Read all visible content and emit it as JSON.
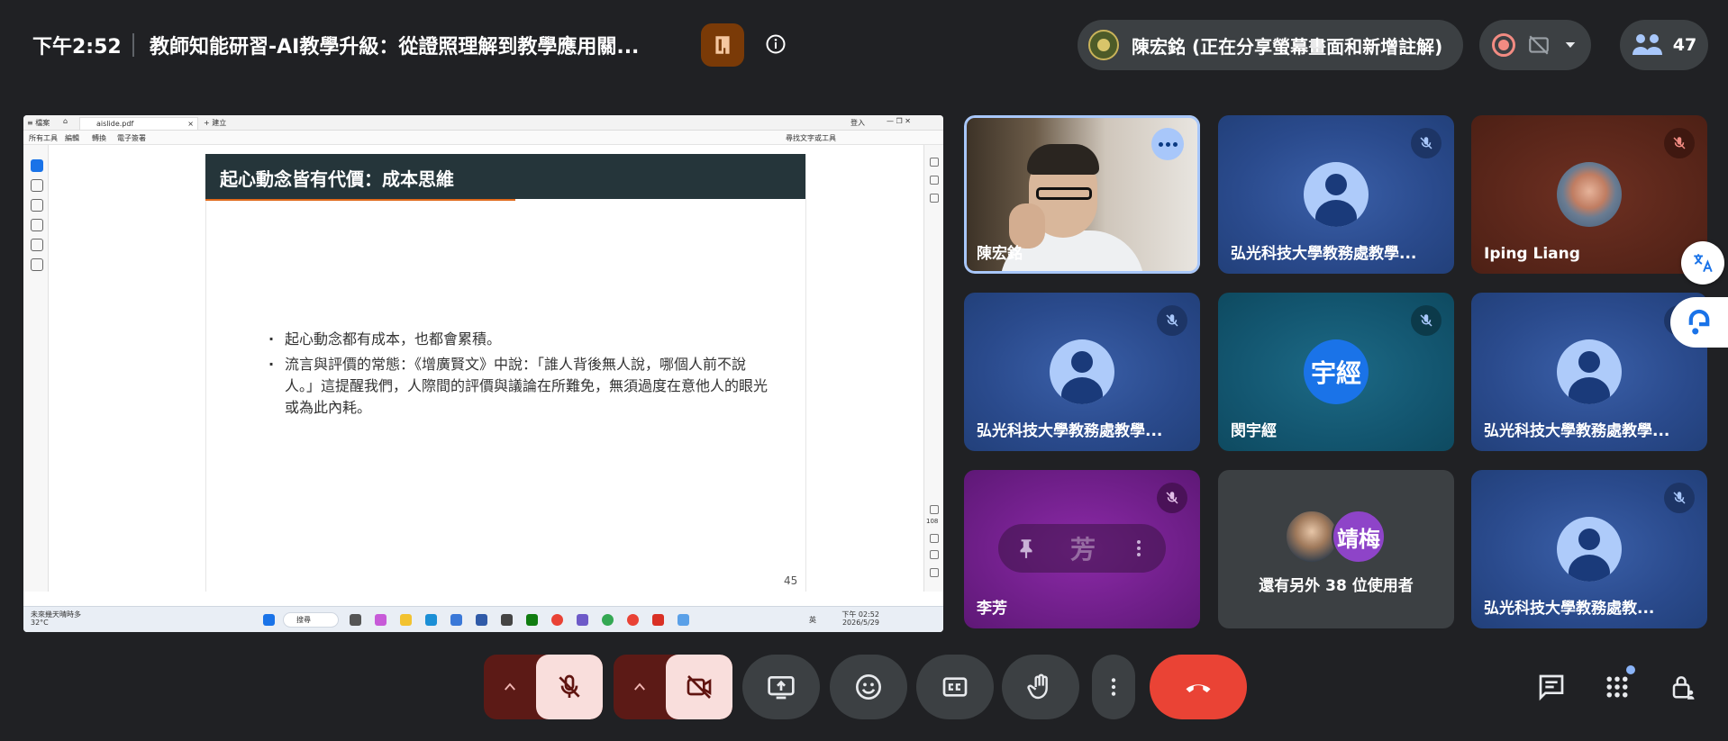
{
  "topbar": {
    "time": "下午2:52",
    "meeting_title": "教師知能研習-AI教學升級：從證照理解到教學應用關...",
    "presenter_text": "陳宏銘 (正在分享螢幕畫面和新增註解)",
    "participant_count": "47"
  },
  "shared_screen": {
    "tab_title": "aislide.pdf",
    "new_tab_label": "+ 建立",
    "menu_items": [
      "所有工具",
      "編輯",
      "轉換",
      "電子簽署"
    ],
    "right_menu": "尋找文字或工具",
    "sign_in": "登入",
    "slide_title": "起心動念皆有代價：成本思維",
    "bullets": [
      "起心動念都有成本，也都會累積。",
      "流言與評價的常態：《增廣賢文》中說：「誰人背後無人說，哪個人前不說人。」這提醒我們，人際間的評價與議論在所難免，無須過度在意他人的眼光或為此內耗。"
    ],
    "page_number": "45",
    "zoom_label": "108",
    "taskbar": {
      "weather_line1": "未來幾天晴時多",
      "weather_line2": "32°C",
      "search_label": "搜尋",
      "ime": "英",
      "clock_time": "下午 02:52",
      "clock_date": "2026/5/29"
    }
  },
  "tiles": [
    {
      "name": "陳宏銘",
      "type": "video"
    },
    {
      "name": "弘光科技大學教務處教學...",
      "type": "generic"
    },
    {
      "name": "Iping Liang",
      "type": "photo"
    },
    {
      "name": "弘光科技大學教務處教學...",
      "type": "generic"
    },
    {
      "name": "閔宇經",
      "type": "letter",
      "letter": "宇經"
    },
    {
      "name": "弘光科技大學教務處教學...",
      "type": "generic"
    },
    {
      "name": "李芳",
      "type": "pinned",
      "letter": "芳"
    },
    {
      "name": "還有另外 38 位使用者",
      "type": "others",
      "letter": "靖梅"
    },
    {
      "name": "弘光科技大學教務處教...",
      "type": "generic"
    }
  ],
  "colors": {
    "background": "#202124",
    "hangup": "#ea4335",
    "muted_bg": "#f9dedc",
    "accent": "#a8c7fa"
  },
  "icons": {
    "host_tools": "host-tools-icon",
    "info": "info-icon",
    "record": "record-icon",
    "captions_off": "no-hd-icon",
    "people": "people-icon",
    "mic_off": "mic-off-icon",
    "cam_off": "camera-off-icon",
    "present": "present-screen-icon",
    "emoji": "emoji-icon",
    "captions": "captions-icon",
    "hand": "raise-hand-icon",
    "more": "more-vert-icon",
    "hangup": "call-end-icon",
    "chat": "chat-icon",
    "activities": "apps-icon",
    "host_controls": "lock-person-icon",
    "translate": "translate-icon"
  }
}
